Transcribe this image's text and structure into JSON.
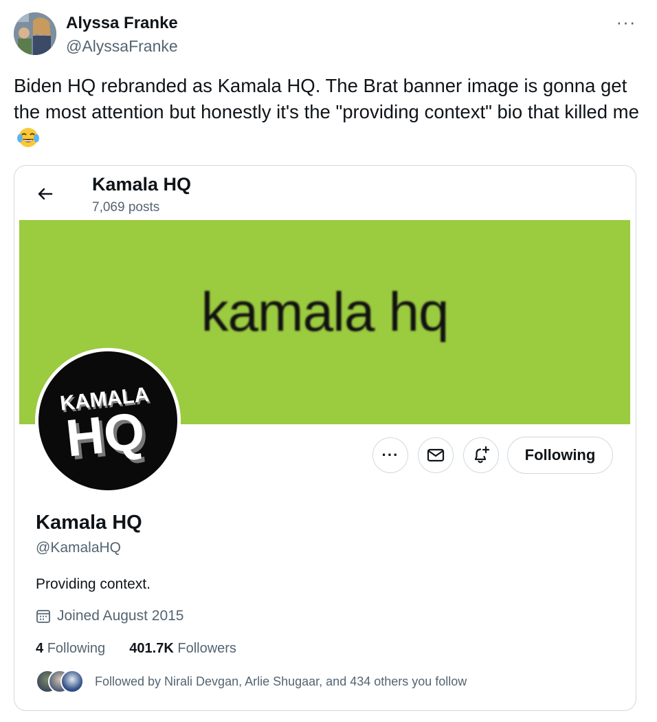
{
  "tweet": {
    "author_name": "Alyssa Franke",
    "author_handle": "@AlyssaFranke",
    "more_label": "···",
    "text": "Biden HQ rebranded as Kamala HQ. The Brat banner image is gonna get the most attention but honestly it's the \"providing context\" bio that killed me"
  },
  "profile": {
    "header_title": "Kamala HQ",
    "posts_count": "7,069 posts",
    "banner_text": "kamala hq",
    "logo_line1": "KAMALA",
    "logo_line2": "HQ",
    "name": "Kamala HQ",
    "handle": "@KamalaHQ",
    "bio": "Providing context.",
    "joined": "Joined August 2015",
    "following_count": "4",
    "following_label": "Following",
    "followers_count": "401.7K",
    "followers_label": "Followers",
    "followed_by": "Followed by Nirali Devgan, Arlie Shugaar, and 434 others you follow",
    "follow_button": "Following",
    "more_button": "···"
  },
  "colors": {
    "banner": "#9bcb3f",
    "text_secondary": "#536471"
  }
}
